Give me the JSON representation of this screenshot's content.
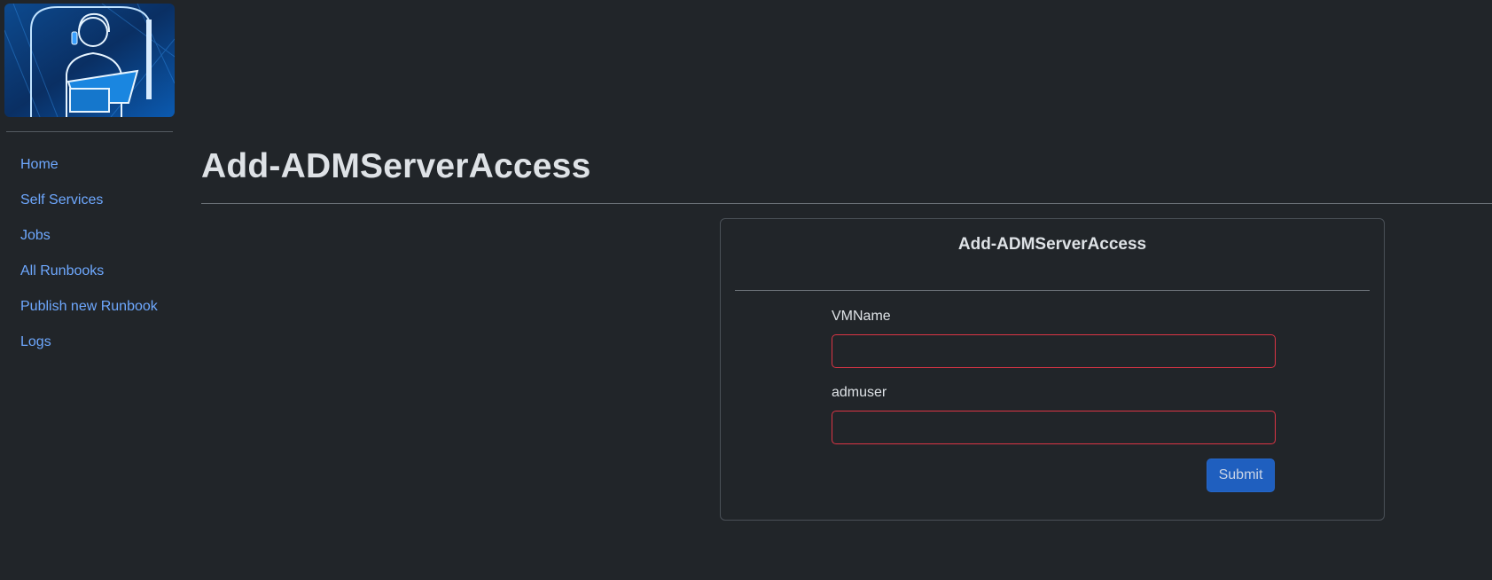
{
  "sidebar": {
    "logo_alt": "helpdesk-agent-logo",
    "items": [
      {
        "label": "Home"
      },
      {
        "label": "Self Services"
      },
      {
        "label": "Jobs"
      },
      {
        "label": "All Runbooks"
      },
      {
        "label": "Publish new Runbook"
      },
      {
        "label": "Logs"
      }
    ]
  },
  "main": {
    "title": "Add-ADMServerAccess"
  },
  "form": {
    "title": "Add-ADMServerAccess",
    "fields": [
      {
        "label": "VMName",
        "value": "",
        "placeholder": ""
      },
      {
        "label": "admuser",
        "value": "",
        "placeholder": ""
      }
    ],
    "submit_label": "Submit"
  },
  "colors": {
    "background": "#212529",
    "link": "#6ea8fe",
    "invalid_border": "#dc3545",
    "primary_button": "#1f5fbf"
  }
}
